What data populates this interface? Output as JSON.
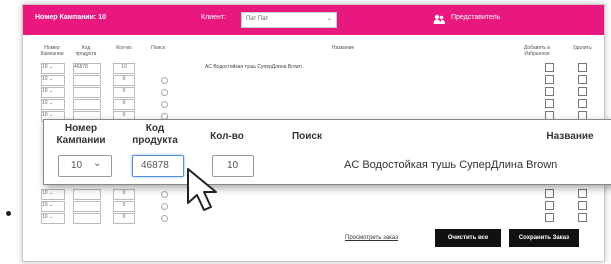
{
  "topbar": {
    "campaign_label": "Номер Кампании: 10",
    "client_label": "Клиент:",
    "client_select": "Пат Пат",
    "user_name": "Представитель"
  },
  "table": {
    "headers": {
      "campaign": "Номер Кампании",
      "product_code": "Код продукта",
      "qty": "Кол-во",
      "search": "Поиск",
      "name": "Название",
      "add_favorites": "Добавить в Избранное",
      "delete": "Удалить"
    },
    "first_row": {
      "campaign": "10",
      "code": "46878",
      "qty": "10",
      "name": "AC Водостойкая тушь СуперДлина Brown"
    },
    "default_campaign": "10",
    "default_qty": "0"
  },
  "buttons": {
    "view_order": "Просмотреть заказ",
    "clear_all": "Очистить все",
    "save_order": "Сохранить Заказ"
  },
  "zoom": {
    "campaign_header": "Номер Кампании",
    "code_header": "Код продукта",
    "qty_header": "Кол-во",
    "search_header": "Поиск",
    "name_header": "Название",
    "campaign_value": "10",
    "code_value": "46878",
    "qty_value": "10",
    "product_name": "AC Водостойкая тушь СуперДлина Brown"
  },
  "colors": {
    "brand": "#e8187f"
  }
}
